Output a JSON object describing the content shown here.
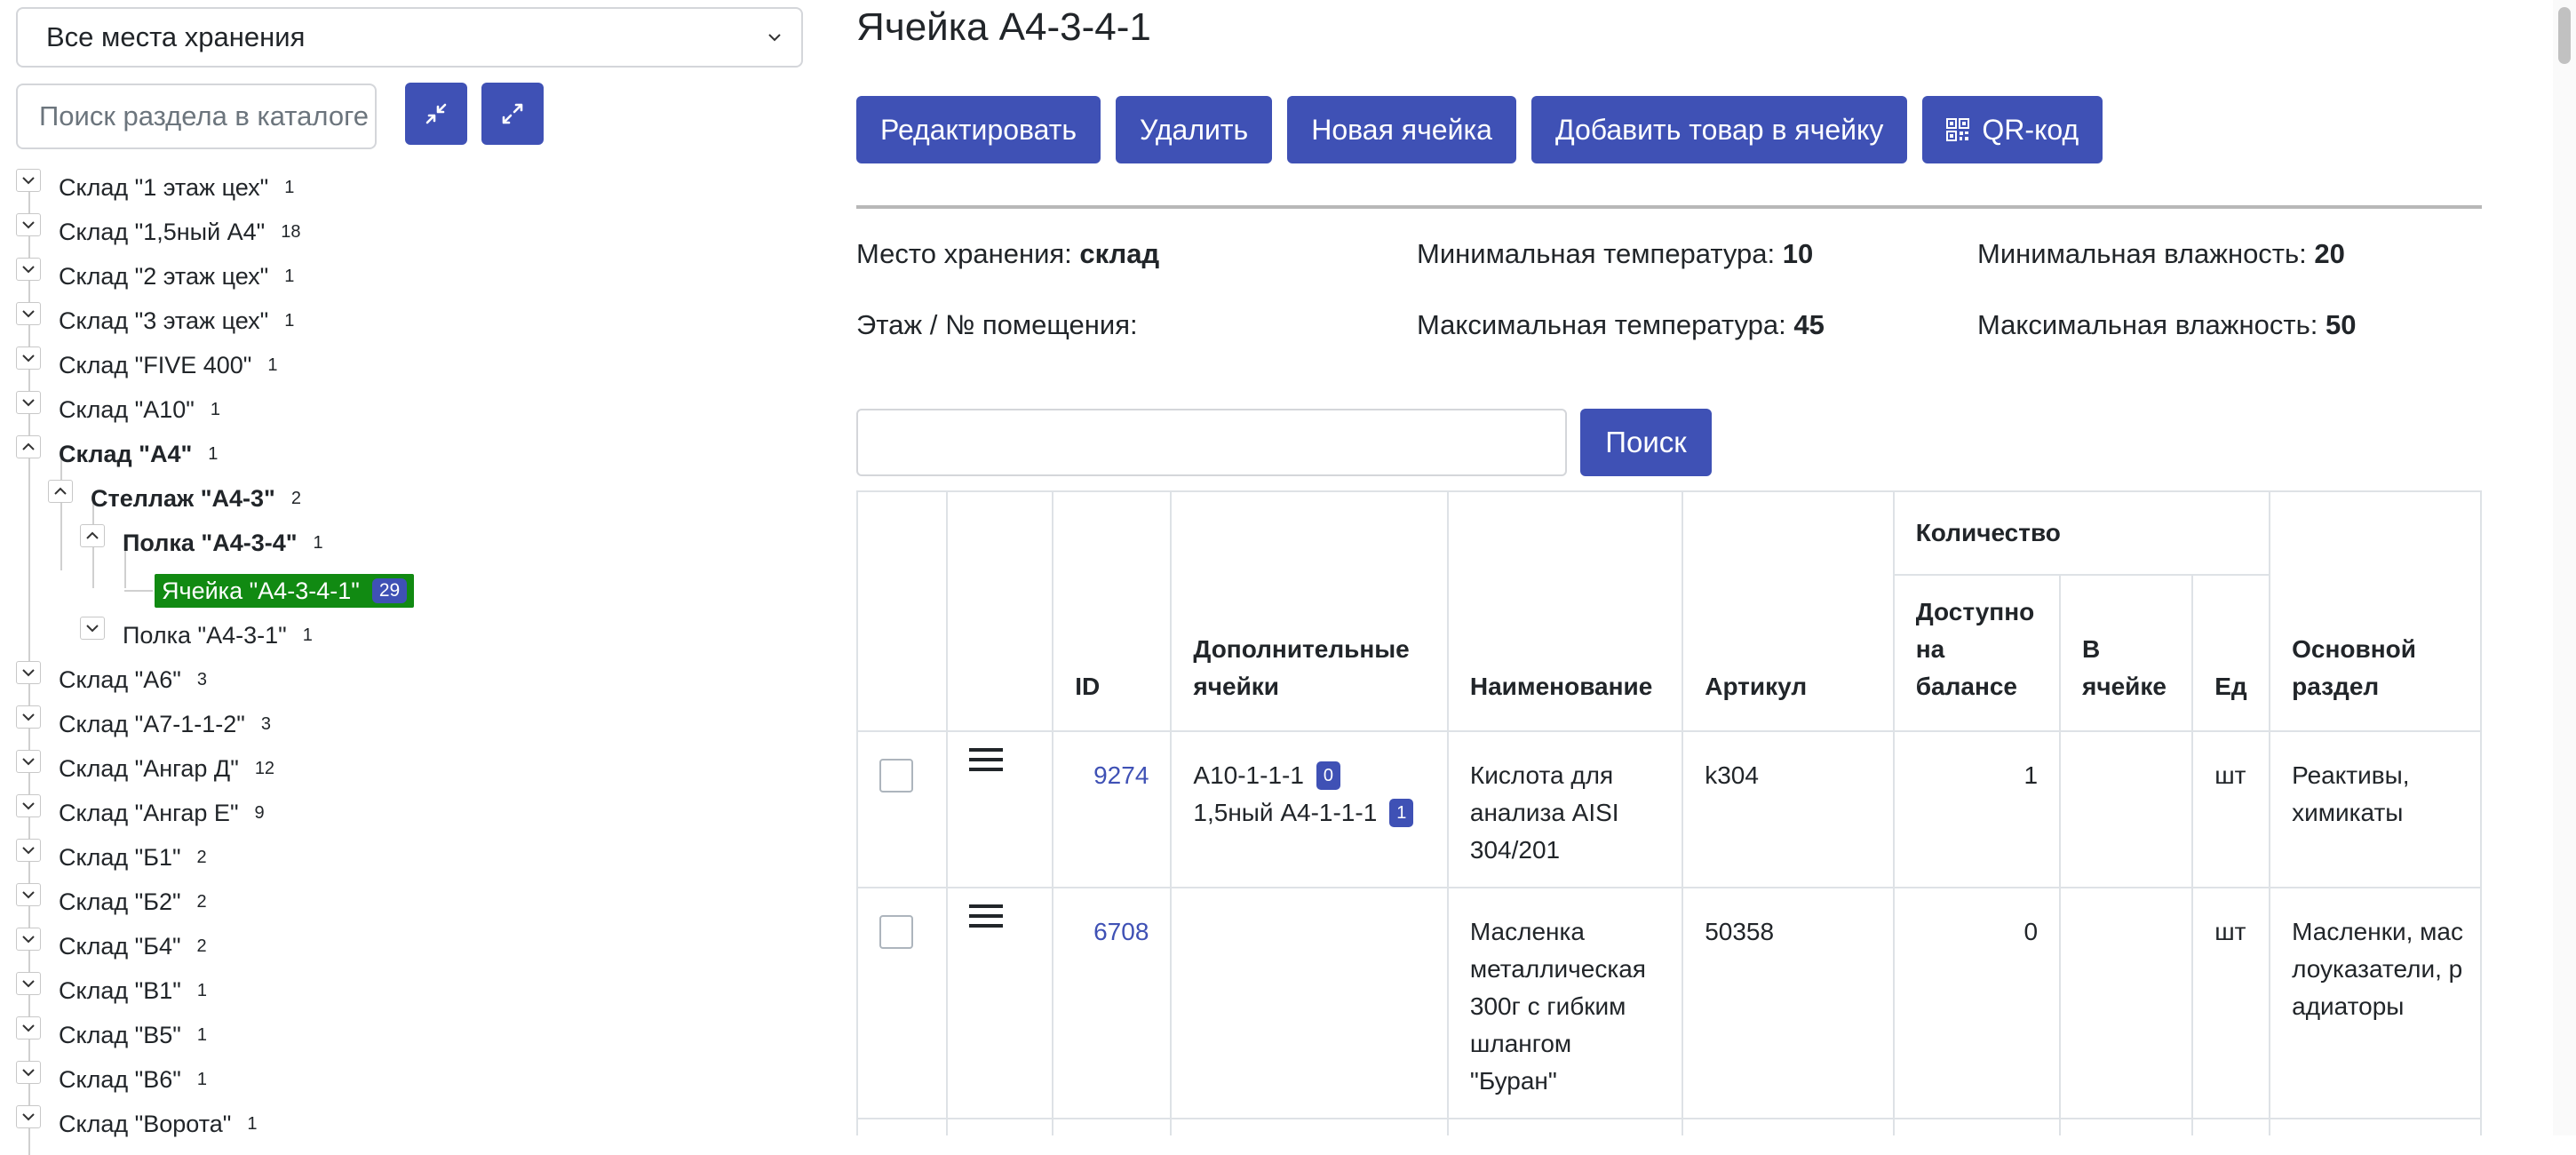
{
  "sidebar": {
    "storage_select": "Все места хранения",
    "catalog_search_placeholder": "Поиск раздела в каталоге",
    "tree": [
      {
        "label": "Склад \"1 этаж цех\"",
        "count": "1"
      },
      {
        "label": "Склад \"1,5ный А4\"",
        "count": "18"
      },
      {
        "label": "Склад \"2 этаж цех\"",
        "count": "1"
      },
      {
        "label": "Склад \"3 этаж цех\"",
        "count": "1"
      },
      {
        "label": "Склад \"FIVE 400\"",
        "count": "1"
      },
      {
        "label": "Склад \"А10\"",
        "count": "1"
      },
      {
        "label": "Склад \"А4\"",
        "count": "1"
      },
      {
        "label": "Стеллаж \"А4-3\"",
        "count": "2"
      },
      {
        "label": "Полка \"А4-3-4\"",
        "count": "1"
      },
      {
        "label": "Ячейка \"А4-3-4-1\"",
        "count": "29"
      },
      {
        "label": "Полка \"А4-3-1\"",
        "count": "1"
      },
      {
        "label": "Склад \"А6\"",
        "count": "3"
      },
      {
        "label": "Склад \"А7-1-1-2\"",
        "count": "3"
      },
      {
        "label": "Склад \"Ангар Д\"",
        "count": "12"
      },
      {
        "label": "Склад \"Ангар Е\"",
        "count": "9"
      },
      {
        "label": "Склад \"Б1\"",
        "count": "2"
      },
      {
        "label": "Склад \"Б2\"",
        "count": "2"
      },
      {
        "label": "Склад \"Б4\"",
        "count": "2"
      },
      {
        "label": "Склад \"В1\"",
        "count": "1"
      },
      {
        "label": "Склад \"В5\"",
        "count": "1"
      },
      {
        "label": "Склад \"В6\"",
        "count": "1"
      },
      {
        "label": "Склад \"Ворота\"",
        "count": "1"
      }
    ]
  },
  "main": {
    "title": "Ячейка А4-3-4-1",
    "actions": {
      "edit": "Редактировать",
      "delete": "Удалить",
      "new_cell": "Новая ячейка",
      "add_item": "Добавить товар в ячейку",
      "qr": "QR-код"
    },
    "props": {
      "storage_label": "Место хранения:",
      "storage_value": "склад",
      "min_temp_label": "Минимальная температура:",
      "min_temp_value": "10",
      "min_hum_label": "Минимальная влажность:",
      "min_hum_value": "20",
      "floor_label": "Этаж / № помещения:",
      "max_temp_label": "Максимальная температура:",
      "max_temp_value": "45",
      "max_hum_label": "Максимальная влажность:",
      "max_hum_value": "50"
    },
    "search_value": "",
    "search_button": "Поиск",
    "table": {
      "headers": {
        "id": "ID",
        "extra_cells": "Дополнительные ячейки",
        "name": "Наименование",
        "sku": "Артикул",
        "quantity_group": "Количество",
        "available": "Доступно на балансе",
        "in_cell": "В ячейке",
        "unit": "Ед",
        "section": "Основной раздел"
      },
      "rows": [
        {
          "id": "9274",
          "extra_cells": [
            {
              "name": "А10-1-1-1",
              "count": "0"
            },
            {
              "name": "1,5ный А4-1-1-1",
              "count": "1"
            }
          ],
          "name": "Кислота для анализа AISI 304/201",
          "sku": "k304",
          "available": "1",
          "in_cell": "",
          "unit": "шт",
          "section": "Реактивы, химикаты"
        },
        {
          "id": "6708",
          "name": "Масленка металлическая 300г с гибким шлангом \"Буран\"",
          "sku": "50358",
          "available": "0",
          "in_cell": "",
          "unit": "шт",
          "section": "Масленки, маслоуказатели, радиаторы"
        }
      ]
    }
  }
}
